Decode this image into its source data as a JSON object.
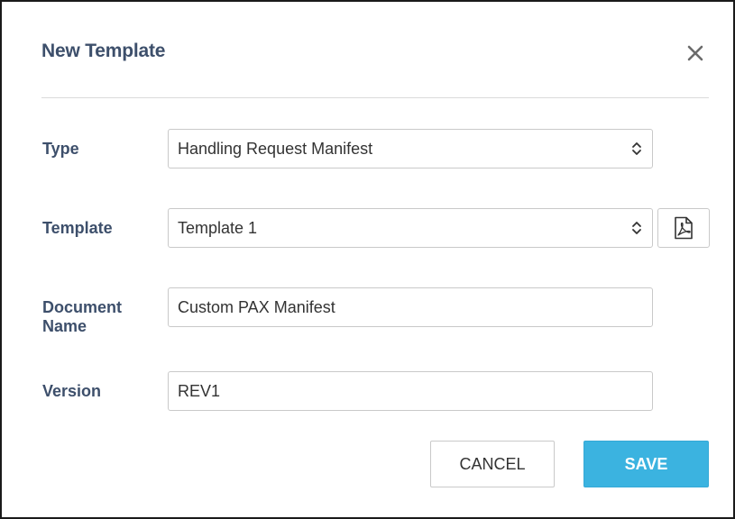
{
  "dialog": {
    "title": "New Template",
    "close_icon": "close-icon"
  },
  "form": {
    "type": {
      "label": "Type",
      "value": "Handling Request Manifest"
    },
    "template": {
      "label": "Template",
      "value": "Template 1",
      "pdf_icon": "pdf-icon"
    },
    "document_name": {
      "label_line1": "Document",
      "label_line2": "Name",
      "value": "Custom PAX Manifest"
    },
    "version": {
      "label": "Version",
      "value": "REV1"
    }
  },
  "actions": {
    "cancel_label": "CANCEL",
    "save_label": "SAVE"
  },
  "colors": {
    "label": "#3d4f6b",
    "save_button": "#3bb3e0",
    "border": "#c9c9c9"
  }
}
